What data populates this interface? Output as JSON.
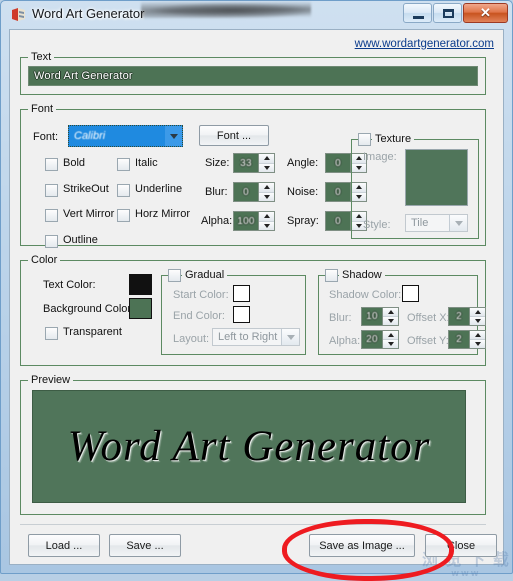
{
  "window": {
    "title": "Word Art Generator",
    "icon": "app-icon",
    "buttons": {
      "minimize": "–",
      "maximize": "□",
      "close": "✕"
    }
  },
  "link": {
    "text": "www.wordartgenerator.com"
  },
  "groups": {
    "text": {
      "label": "Text",
      "value": "Word Art Generator"
    },
    "font": {
      "label": "Font",
      "font_label": "Font:",
      "font_value": "Calibri",
      "font_button": "Font ...",
      "checkboxes": [
        {
          "label": "Bold",
          "checked": false
        },
        {
          "label": "Italic",
          "checked": false
        },
        {
          "label": "StrikeOut",
          "checked": false
        },
        {
          "label": "Underline",
          "checked": false
        },
        {
          "label": "Vert Mirror",
          "checked": false
        },
        {
          "label": "Horz Mirror",
          "checked": false
        },
        {
          "label": "Outline",
          "checked": false
        }
      ],
      "spinners": [
        {
          "label": "Size:",
          "value": "33"
        },
        {
          "label": "Angle:",
          "value": "0"
        },
        {
          "label": "Blur:",
          "value": "0"
        },
        {
          "label": "Noise:",
          "value": "0"
        },
        {
          "label": "Alpha:",
          "value": "100"
        },
        {
          "label": "Spray:",
          "value": "0"
        }
      ]
    },
    "texture": {
      "label": "Texture",
      "checked": false,
      "image_label": "Image:",
      "style_label": "Style:",
      "style_value": "Tile"
    },
    "color": {
      "label": "Color",
      "text_color_label": "Text Color:",
      "text_color": "#111111",
      "background_color_label": "Background Color",
      "background_color": "#4d7355",
      "transparent_label": "Transparent",
      "transparent_checked": false
    },
    "gradual": {
      "label": "Gradual",
      "checked": false,
      "start_color_label": "Start Color:",
      "start_color": "#ffffff",
      "end_color_label": "End Color:",
      "end_color": "#ffffff",
      "layout_label": "Layout:",
      "layout_value": "Left to Right"
    },
    "shadow": {
      "label": "Shadow",
      "checked": false,
      "shadow_color_label": "Shadow Color:",
      "shadow_color": "#ffffff",
      "blur_label": "Blur:",
      "blur_value": "10",
      "alpha_label": "Alpha:",
      "alpha_value": "20",
      "offset_x_label": "Offset X:",
      "offset_x_value": "2",
      "offset_y_label": "Offset Y:",
      "offset_y_value": "2"
    },
    "preview": {
      "label": "Preview",
      "text": "Word Art Generator"
    }
  },
  "footer": {
    "load": "Load ...",
    "save": "Save ...",
    "save_as_image": "Save as Image ...",
    "close": "Close"
  },
  "watermark": {
    "text": "浏 览 下 载",
    "sub": "WWW"
  },
  "accent": {
    "group_border": "#5c8a62",
    "field_green": "#4d7355",
    "highlight_red": "#ee1b20"
  }
}
